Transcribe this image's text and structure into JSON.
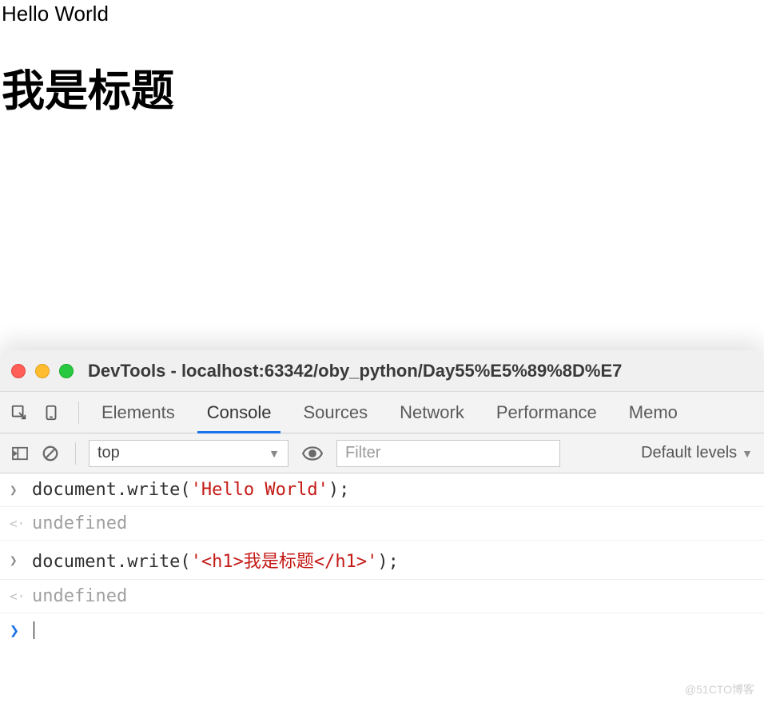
{
  "page": {
    "hello_text": "Hello World",
    "heading_text": "我是标题"
  },
  "devtools": {
    "title": "DevTools - localhost:63342/oby_python/Day55%E5%89%8D%E7",
    "tabs": {
      "elements": "Elements",
      "console": "Console",
      "sources": "Sources",
      "network": "Network",
      "performance": "Performance",
      "memory": "Memo"
    },
    "toolbar": {
      "context": "top",
      "filter_placeholder": "Filter",
      "levels": "Default levels"
    },
    "console": {
      "line1_prefix": "document.write(",
      "line1_string": "'Hello World'",
      "line1_suffix": ");",
      "line2": "undefined",
      "line3_prefix": "document.write(",
      "line3_string": "'<h1>我是标题</h1>'",
      "line3_suffix": ");",
      "line4": "undefined"
    }
  },
  "watermark": "@51CTO博客"
}
